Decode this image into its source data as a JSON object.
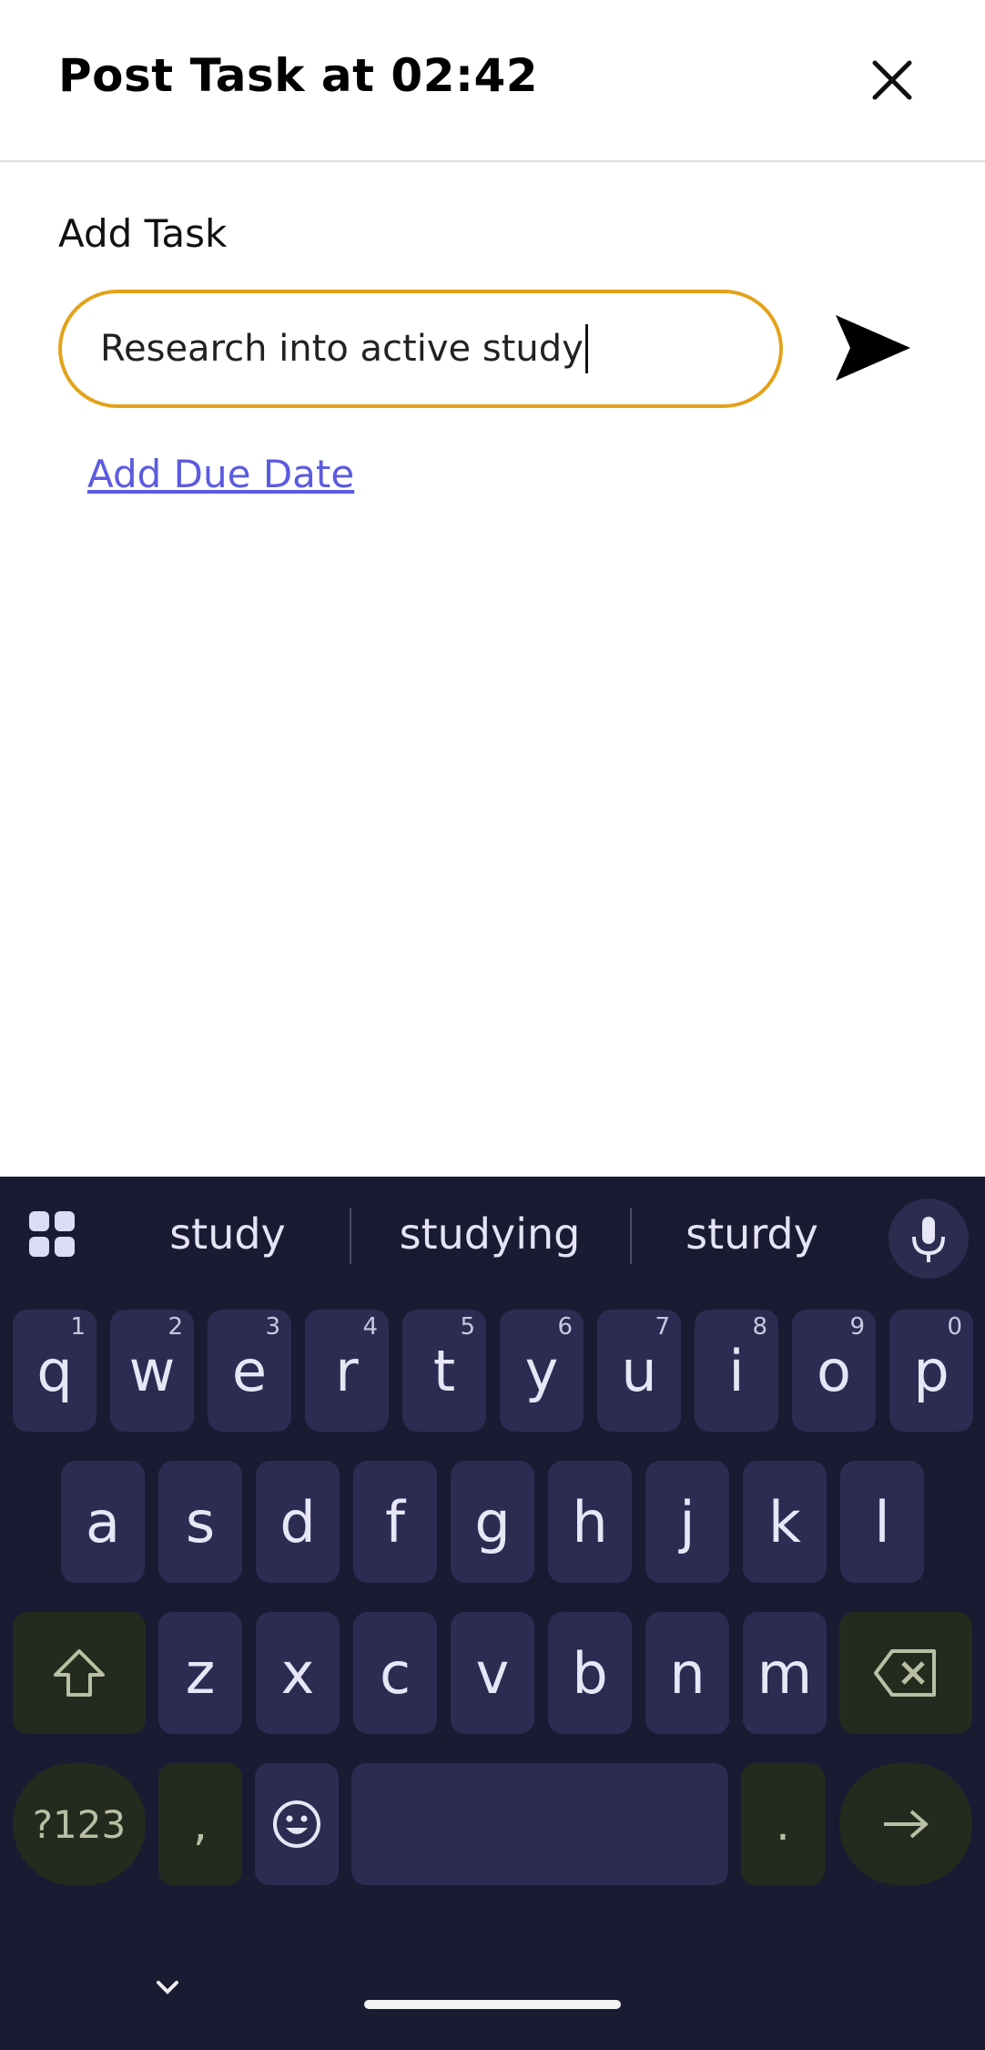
{
  "header": {
    "title": "Post Task at 02:42"
  },
  "form": {
    "label": "Add Task",
    "input_value": "Research into active study",
    "due_date_link": "Add Due Date"
  },
  "keyboard": {
    "suggestions": [
      "study",
      "studying",
      "sturdy"
    ],
    "row1": [
      {
        "k": "q",
        "n": "1"
      },
      {
        "k": "w",
        "n": "2"
      },
      {
        "k": "e",
        "n": "3"
      },
      {
        "k": "r",
        "n": "4"
      },
      {
        "k": "t",
        "n": "5"
      },
      {
        "k": "y",
        "n": "6"
      },
      {
        "k": "u",
        "n": "7"
      },
      {
        "k": "i",
        "n": "8"
      },
      {
        "k": "o",
        "n": "9"
      },
      {
        "k": "p",
        "n": "0"
      }
    ],
    "row2": [
      "a",
      "s",
      "d",
      "f",
      "g",
      "h",
      "j",
      "k",
      "l"
    ],
    "row3": [
      "z",
      "x",
      "c",
      "v",
      "b",
      "n",
      "m"
    ],
    "symbols_key": "?123",
    "comma_key": ",",
    "period_key": "."
  },
  "colors": {
    "input_border": "#e3a21a",
    "link": "#5b5be0",
    "keyboard_bg": "#1a1a33",
    "key_bg": "#2c2c52",
    "func_key_bg": "#252a1e"
  }
}
